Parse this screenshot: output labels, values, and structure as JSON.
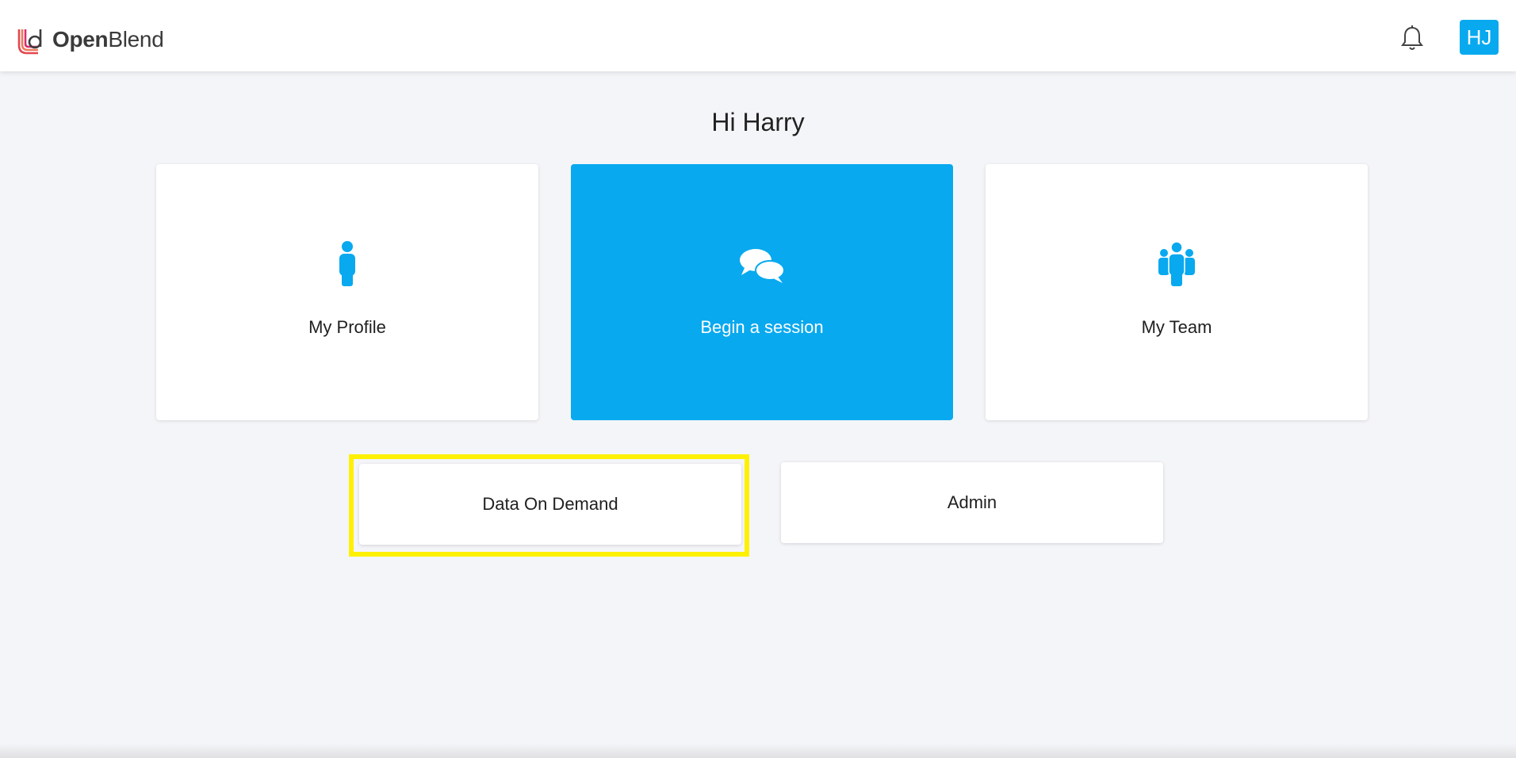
{
  "header": {
    "logo_text_bold": "Open",
    "logo_text_light": "Blend",
    "avatar_initials": "HJ",
    "avatar_color": "#08a9ef"
  },
  "greeting": "Hi Harry",
  "cards": [
    {
      "label": "My Profile",
      "icon": "person-icon"
    },
    {
      "label": "Begin a session",
      "icon": "chat-bubbles-icon",
      "background": "#08a9ef"
    },
    {
      "label": "My Team",
      "icon": "team-icon"
    }
  ],
  "secondary_cards": [
    {
      "label": "Data On Demand",
      "highlighted": true
    },
    {
      "label": "Admin"
    }
  ],
  "colors": {
    "accent": "#08a9ef",
    "highlight": "#fdf000",
    "background": "#f4f5f8"
  }
}
